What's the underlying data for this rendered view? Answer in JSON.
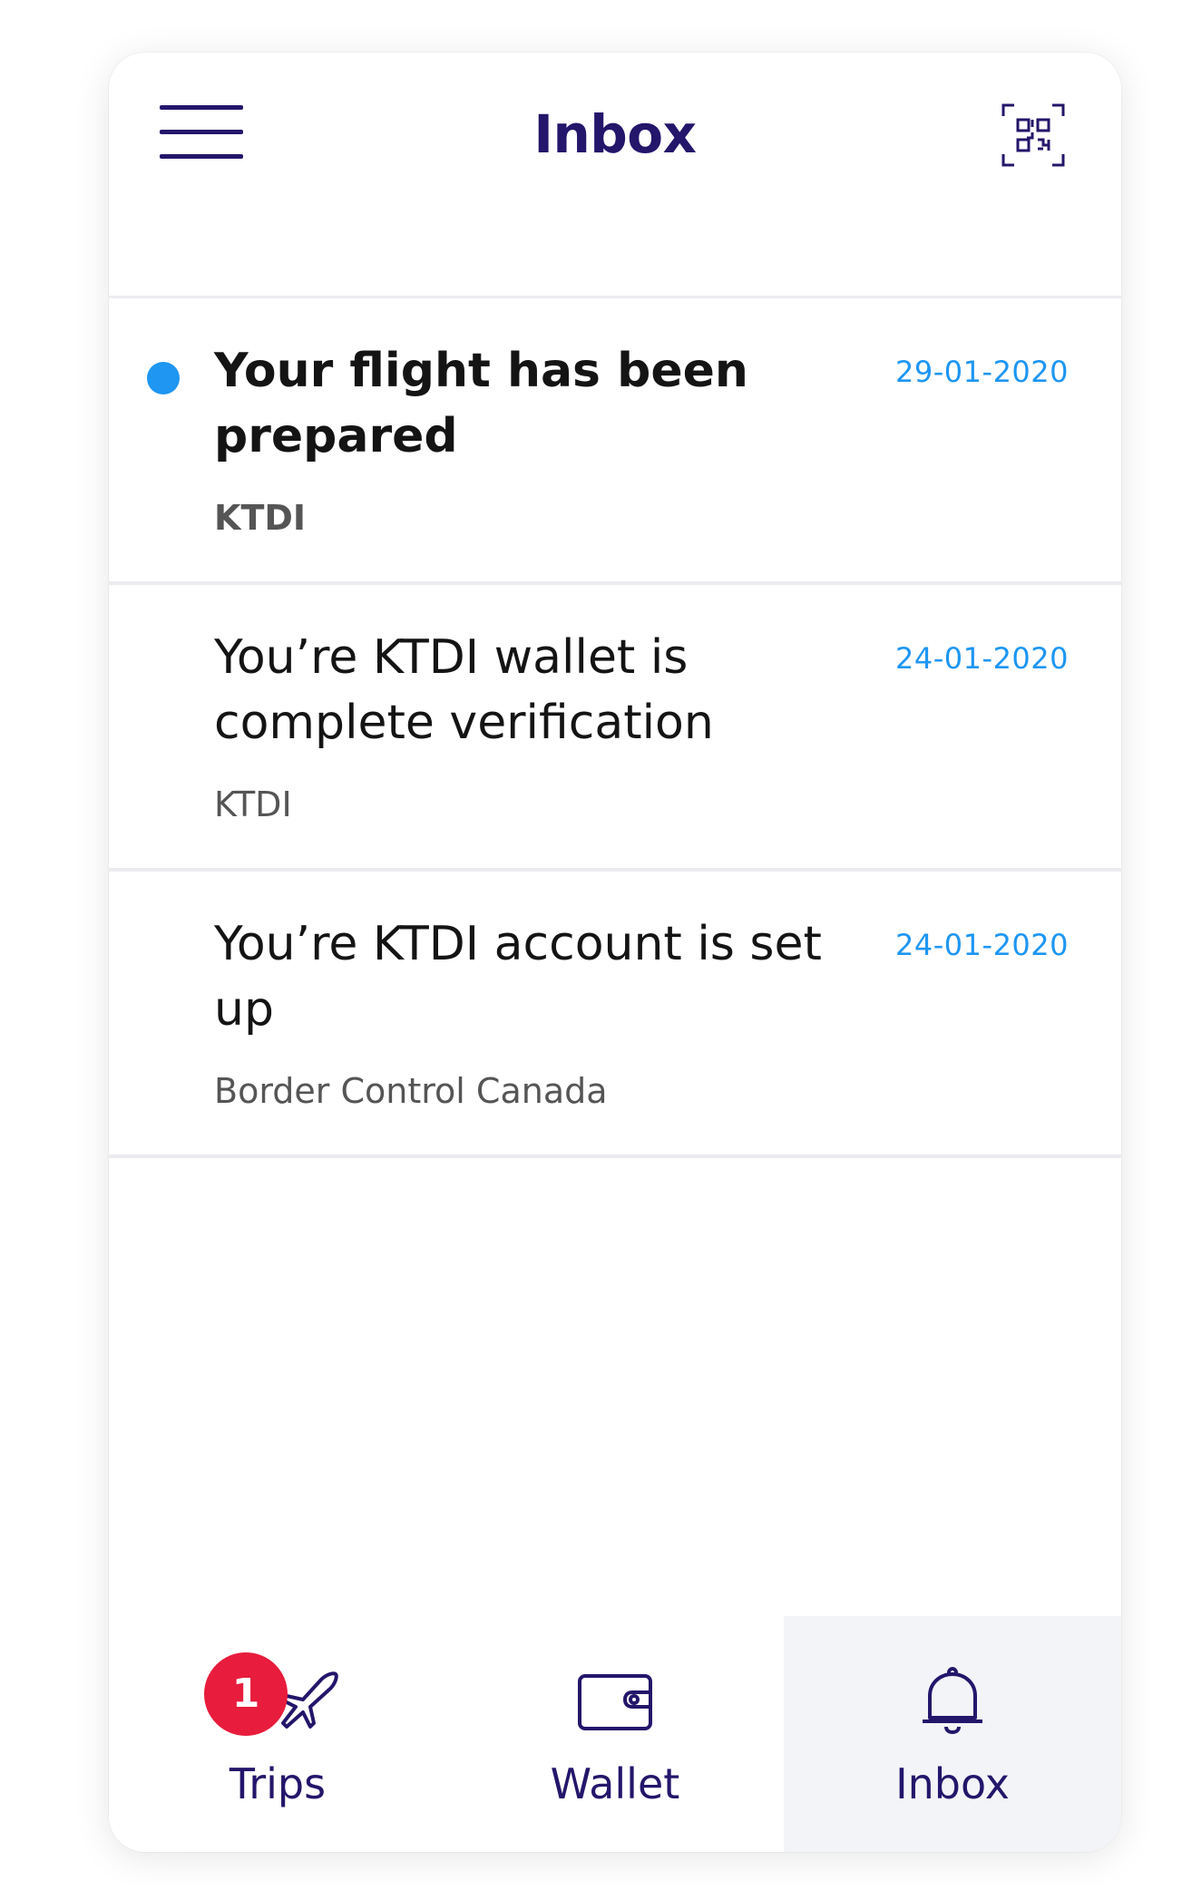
{
  "header": {
    "title": "Inbox",
    "menu_icon": "hamburger-menu-icon",
    "scan_icon": "qr-scan-icon"
  },
  "messages": [
    {
      "title": "Your flight has been prepared",
      "date": "29-01-2020",
      "sender": "KTDI",
      "unread": true
    },
    {
      "title": "You’re KTDI wallet is complete verification",
      "date": "24-01-2020",
      "sender": "KTDI",
      "unread": false
    },
    {
      "title": "You’re KTDI account is set up",
      "date": "24-01-2020",
      "sender": "Border Control Canada",
      "unread": false
    }
  ],
  "bottom_nav": {
    "items": [
      {
        "label": "Trips",
        "icon": "plane-icon",
        "badge": "1",
        "active": false
      },
      {
        "label": "Wallet",
        "icon": "wallet-icon",
        "active": false
      },
      {
        "label": "Inbox",
        "icon": "bell-icon",
        "active": true
      }
    ]
  },
  "colors": {
    "primary": "#23166b",
    "accent": "#1e96f2",
    "badge": "#e81c3c",
    "divider": "#ececf0",
    "active_tab_bg": "#f2f4f8"
  }
}
